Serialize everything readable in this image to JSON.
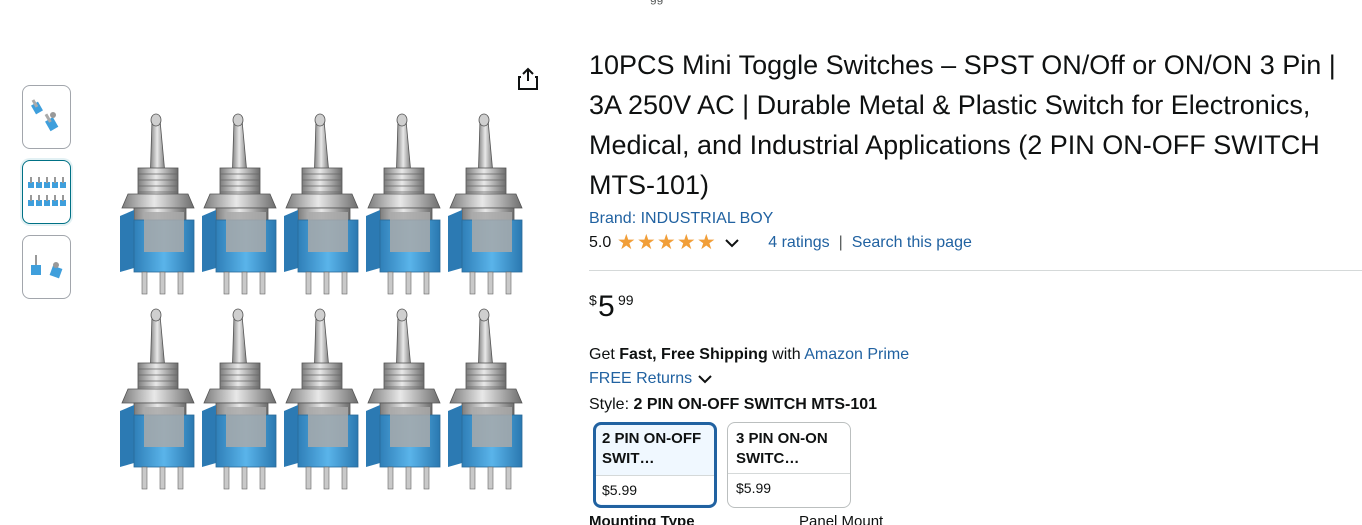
{
  "top_fragment": "gg",
  "thumbnails": [
    {
      "icon": "two-switches-thumb"
    },
    {
      "icon": "ten-switches-thumb"
    },
    {
      "icon": "switch-pair-thumb"
    }
  ],
  "product": {
    "title": "10PCS Mini Toggle Switches – SPST ON/Off or ON/ON 3 Pin | 3A 250V AC | Durable Metal & Plastic Switch for Electronics, Medical, and Industrial Applications (2 PIN ON-OFF SWITCH MTS-101)",
    "brand": "Brand: INDUSTRIAL BOY",
    "rating": "5.0",
    "stars": 5,
    "ratings_count": "4 ratings",
    "separator": "|",
    "search_link": "Search this page"
  },
  "price": {
    "currency": "$",
    "whole": "5",
    "fraction": "99"
  },
  "shipping": {
    "get": "Get",
    "fast": "Fast, Free Shipping",
    "with": "with",
    "prime": "Amazon Prime",
    "returns": "FREE Returns"
  },
  "style": {
    "label": "Style:",
    "value": "2 PIN ON-OFF SWITCH MTS-101",
    "options": [
      {
        "name": "2 PIN ON-OFF SWIT…",
        "price": "$5.99",
        "selected": true
      },
      {
        "name": "3 PIN ON-ON SWITC…",
        "price": "$5.99",
        "selected": false
      }
    ]
  },
  "details": {
    "mounting_type_label": "Mounting Type",
    "mounting_type_value": "Panel Mount"
  },
  "colors": {
    "link": "#2162a1",
    "star": "#f19e38",
    "switch_blue": "#3f9fdc",
    "switch_metal": "#b8b8b8"
  }
}
